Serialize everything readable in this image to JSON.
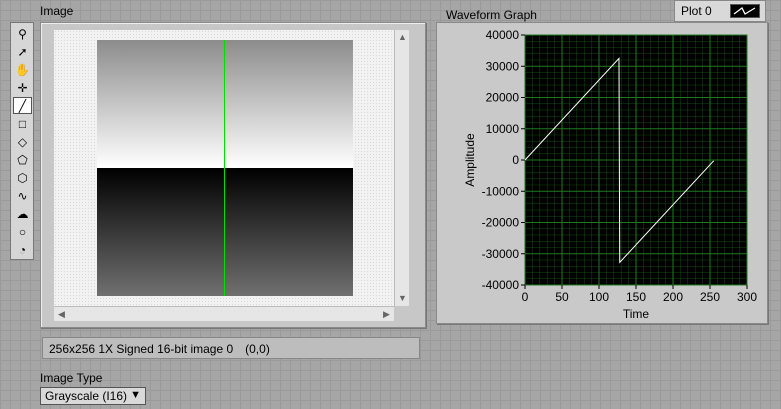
{
  "image_panel": {
    "label": "Image",
    "tools": [
      {
        "name": "zoom-icon",
        "glyph": "⚲"
      },
      {
        "name": "select-arrow-icon",
        "glyph": "➚"
      },
      {
        "name": "pan-hand-icon",
        "glyph": "✋"
      },
      {
        "name": "crosshair-icon",
        "glyph": "✛"
      },
      {
        "name": "line-tool-icon",
        "glyph": "╱"
      },
      {
        "name": "rectangle-tool-icon",
        "glyph": "□"
      },
      {
        "name": "rotated-rectangle-icon",
        "glyph": "◇"
      },
      {
        "name": "polygon-tool-icon",
        "glyph": "⬠"
      },
      {
        "name": "annulus-arc-icon",
        "glyph": "⬡"
      },
      {
        "name": "freehand-line-icon",
        "glyph": "∿"
      },
      {
        "name": "freehand-region-icon",
        "glyph": "☁"
      },
      {
        "name": "oval-tool-icon",
        "glyph": "○"
      },
      {
        "name": "annulus-tool-icon",
        "glyph": "◔"
      }
    ],
    "status_info": "256x256 1X Signed 16-bit image 0",
    "status_coords": "(0,0)"
  },
  "image_type": {
    "label": "Image Type",
    "selected": "Grayscale (I16)"
  },
  "graph": {
    "title": "Waveform Graph",
    "legend_label": "Plot 0",
    "colors": {
      "plot_bg": "#000000",
      "grid": "#1f7a1f",
      "trace": "#ffffff"
    }
  },
  "chart_data": {
    "type": "line",
    "xlabel": "Time",
    "ylabel": "Amplitude",
    "xlim": [
      0,
      300
    ],
    "ylim": [
      -40000,
      40000
    ],
    "x_ticks": [
      0,
      50,
      100,
      150,
      200,
      250,
      300
    ],
    "y_ticks": [
      40000,
      30000,
      20000,
      10000,
      0,
      -10000,
      -20000,
      -30000,
      -40000
    ],
    "grid": true,
    "series": [
      {
        "name": "Plot 0",
        "x": [
          0,
          127,
          128,
          255
        ],
        "y": [
          0,
          32512,
          -32768,
          -256
        ]
      }
    ]
  }
}
